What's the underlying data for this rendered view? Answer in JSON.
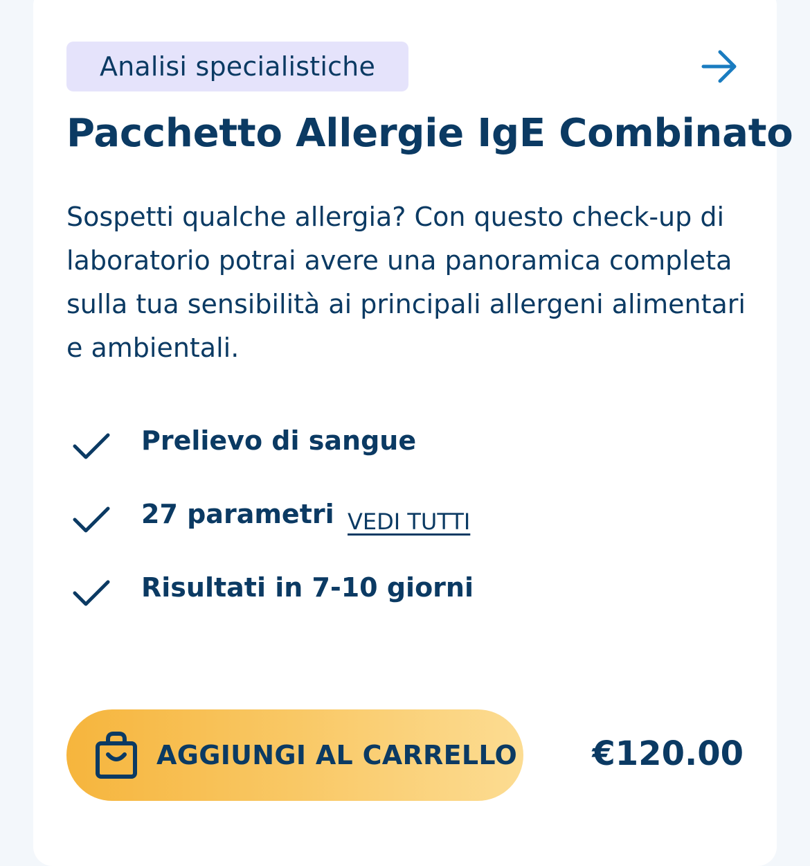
{
  "product": {
    "category": "Analisi specialistiche",
    "title": "Pacchetto Allergie IgE Combinato",
    "description": "Sospetti qualche allergia? Con questo check-up di laboratorio potrai avere una panoramica completa sulla tua sensibilità ai principali allergeni alimentari e ambientali.",
    "features": [
      {
        "label": "Prelievo di sangue"
      },
      {
        "label": "27 parametri",
        "link": "VEDI TUTTI"
      },
      {
        "label": "Risultati in 7-10 giorni"
      }
    ],
    "cart_button_label": "AGGIUNGI AL CARRELLO",
    "price": "€120.00"
  },
  "icons": {
    "arrow": "arrow-right-icon",
    "check": "check-icon",
    "cart": "shopping-bag-icon"
  },
  "colors": {
    "text": "#0b3a63",
    "badge_background": "#e5e3fb",
    "arrow": "#1a7cc0",
    "button_gradient_start": "#f6b53d",
    "button_gradient_end": "#fcdc92",
    "page_background": "#f3f7fb",
    "card_background": "#ffffff"
  }
}
